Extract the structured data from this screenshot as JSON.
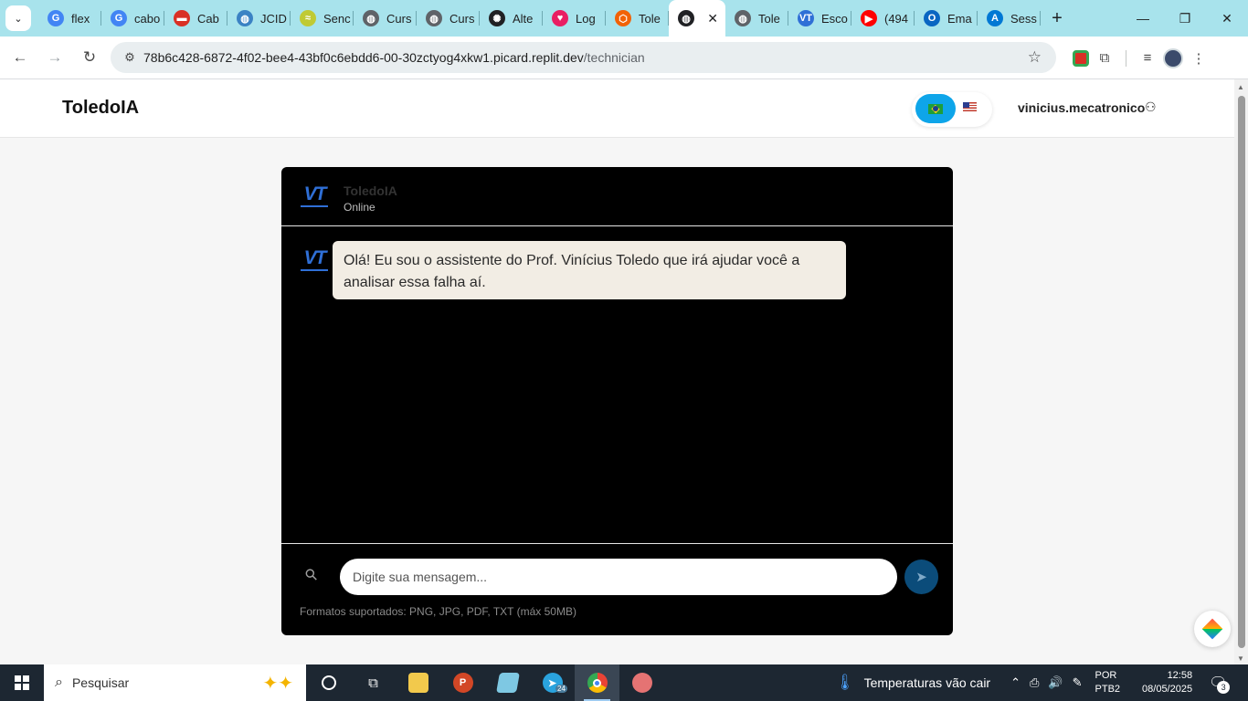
{
  "browser": {
    "tabs": [
      {
        "label": "flex",
        "icon": "google-icon",
        "color": "#4285f4"
      },
      {
        "label": "cabo",
        "icon": "google-icon",
        "color": "#4285f4"
      },
      {
        "label": "Cab",
        "icon": "pdf-icon",
        "color": "#d93025"
      },
      {
        "label": "JCID",
        "icon": "globe-icon",
        "color": "#3b82c4"
      },
      {
        "label": "Senc",
        "icon": "sendpulse-icon",
        "color": "#c0ca33"
      },
      {
        "label": "Curs",
        "icon": "globe-icon",
        "color": "#5f6368"
      },
      {
        "label": "Curs",
        "icon": "globe-icon",
        "color": "#5f6368"
      },
      {
        "label": "Alte",
        "icon": "openai-icon",
        "color": "#202124"
      },
      {
        "label": "Log",
        "icon": "heart-icon",
        "color": "#e91e63"
      },
      {
        "label": "Tole",
        "icon": "replit-icon",
        "color": "#f26207"
      },
      {
        "label": "",
        "icon": "globe-icon",
        "color": "#202124",
        "active": true
      },
      {
        "label": "Tole",
        "icon": "globe-icon",
        "color": "#5f6368"
      },
      {
        "label": "Esco",
        "icon": "vt-icon",
        "color": "#2f6fd6"
      },
      {
        "label": "(494",
        "icon": "youtube-icon",
        "color": "#ff0000"
      },
      {
        "label": "Ema",
        "icon": "outlook-icon",
        "color": "#0a66c2"
      },
      {
        "label": "Sess",
        "icon": "azure-icon",
        "color": "#0078d4"
      }
    ],
    "url_host": "78b6c428-6872-4f02-bee4-43bf0c6ebdd6-00-30zctyog4xkw1.picard.replit.dev",
    "url_path": "/technician"
  },
  "app": {
    "brand": "ToledoIA",
    "username": "vinicius.mecatronico"
  },
  "chat": {
    "bot_name": "ToledoIA",
    "bot_status": "Online",
    "logo_text": "VT",
    "messages": [
      {
        "text": "Olá! Eu sou o assistente do Prof. Vinícius Toledo que irá ajudar você a analisar essa falha aí."
      }
    ],
    "input_placeholder": "Digite sua mensagem...",
    "formats_note": "Formatos suportados: PNG, JPG, PDF, TXT (máx 50MB)"
  },
  "taskbar": {
    "search_label": "Pesquisar",
    "telegram_badge": "24",
    "weather": "Temperaturas vão cair",
    "lang_line1": "POR",
    "lang_line2": "PTB2",
    "time": "12:58",
    "date": "08/05/2025",
    "notifications": "3"
  },
  "colors": {
    "accent_blue": "#0ea5e9",
    "chat_bg": "#000000",
    "bubble_bg": "#f2ede4",
    "send_button": "#0b4c7a",
    "tabstrip": "#a8e3ec"
  }
}
